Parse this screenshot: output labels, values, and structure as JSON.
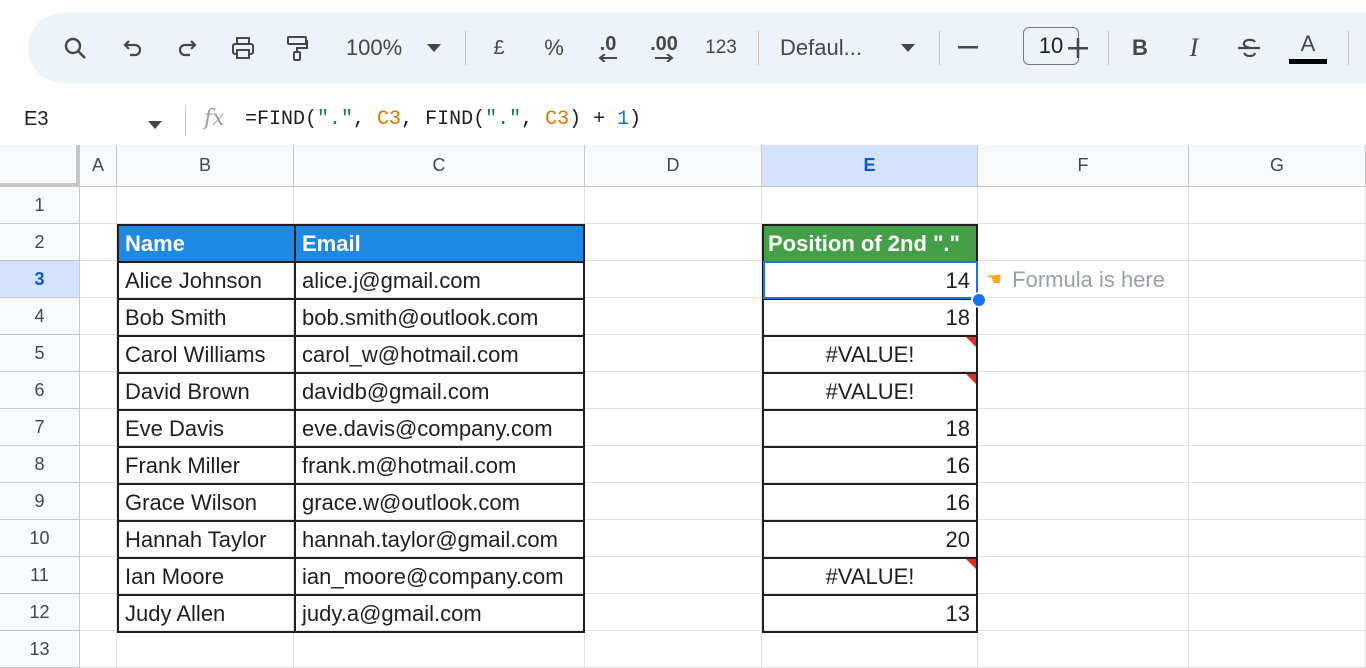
{
  "toolbar": {
    "zoom": "100%",
    "currency": "£",
    "percent": "%",
    "decrease_decimal": ".0",
    "increase_decimal": ".00",
    "number_format": "123",
    "font": "Defaul...",
    "font_size": "10",
    "bold": "B",
    "italic": "I",
    "text_color": "A"
  },
  "formula_bar": {
    "cell_ref": "E3",
    "fx": "fx",
    "formula_parts": [
      "=FIND(",
      "\".\"",
      ", ",
      "C3",
      ", FIND(",
      "\".\"",
      ", ",
      "C3",
      ") + ",
      "1",
      ")"
    ]
  },
  "columns": [
    "A",
    "B",
    "C",
    "D",
    "E",
    "F",
    "G"
  ],
  "selected_column": "E",
  "rows": [
    "1",
    "2",
    "3",
    "4",
    "5",
    "6",
    "7",
    "8",
    "9",
    "10",
    "11",
    "12",
    "13"
  ],
  "selected_row": "3",
  "table": {
    "headers": [
      "Name",
      "Email"
    ],
    "rows": [
      [
        "Alice Johnson",
        "alice.j@gmail.com"
      ],
      [
        "Bob Smith",
        "bob.smith@outlook.com"
      ],
      [
        "Carol Williams",
        "carol_w@hotmail.com"
      ],
      [
        "David Brown",
        "davidb@gmail.com"
      ],
      [
        "Eve Davis",
        "eve.davis@company.com"
      ],
      [
        "Frank Miller",
        "frank.m@hotmail.com"
      ],
      [
        "Grace Wilson",
        "grace.w@outlook.com"
      ],
      [
        "Hannah Taylor",
        "hannah.taylor@gmail.com"
      ],
      [
        "Ian Moore",
        "ian_moore@company.com"
      ],
      [
        "Judy Allen",
        "judy.a@gmail.com"
      ]
    ]
  },
  "result": {
    "header": "Position of 2nd \".\"",
    "values": [
      "14",
      "18",
      "#VALUE!",
      "#VALUE!",
      "18",
      "16",
      "16",
      "20",
      "#VALUE!",
      "13"
    ]
  },
  "note": {
    "icon": "pointing-hand-icon",
    "text": "Formula is here"
  },
  "colors": {
    "name_header_bg": "#1e88e5",
    "result_header_bg": "#43a047",
    "selection": "#1a73e8",
    "error_marker": "#d93025"
  }
}
